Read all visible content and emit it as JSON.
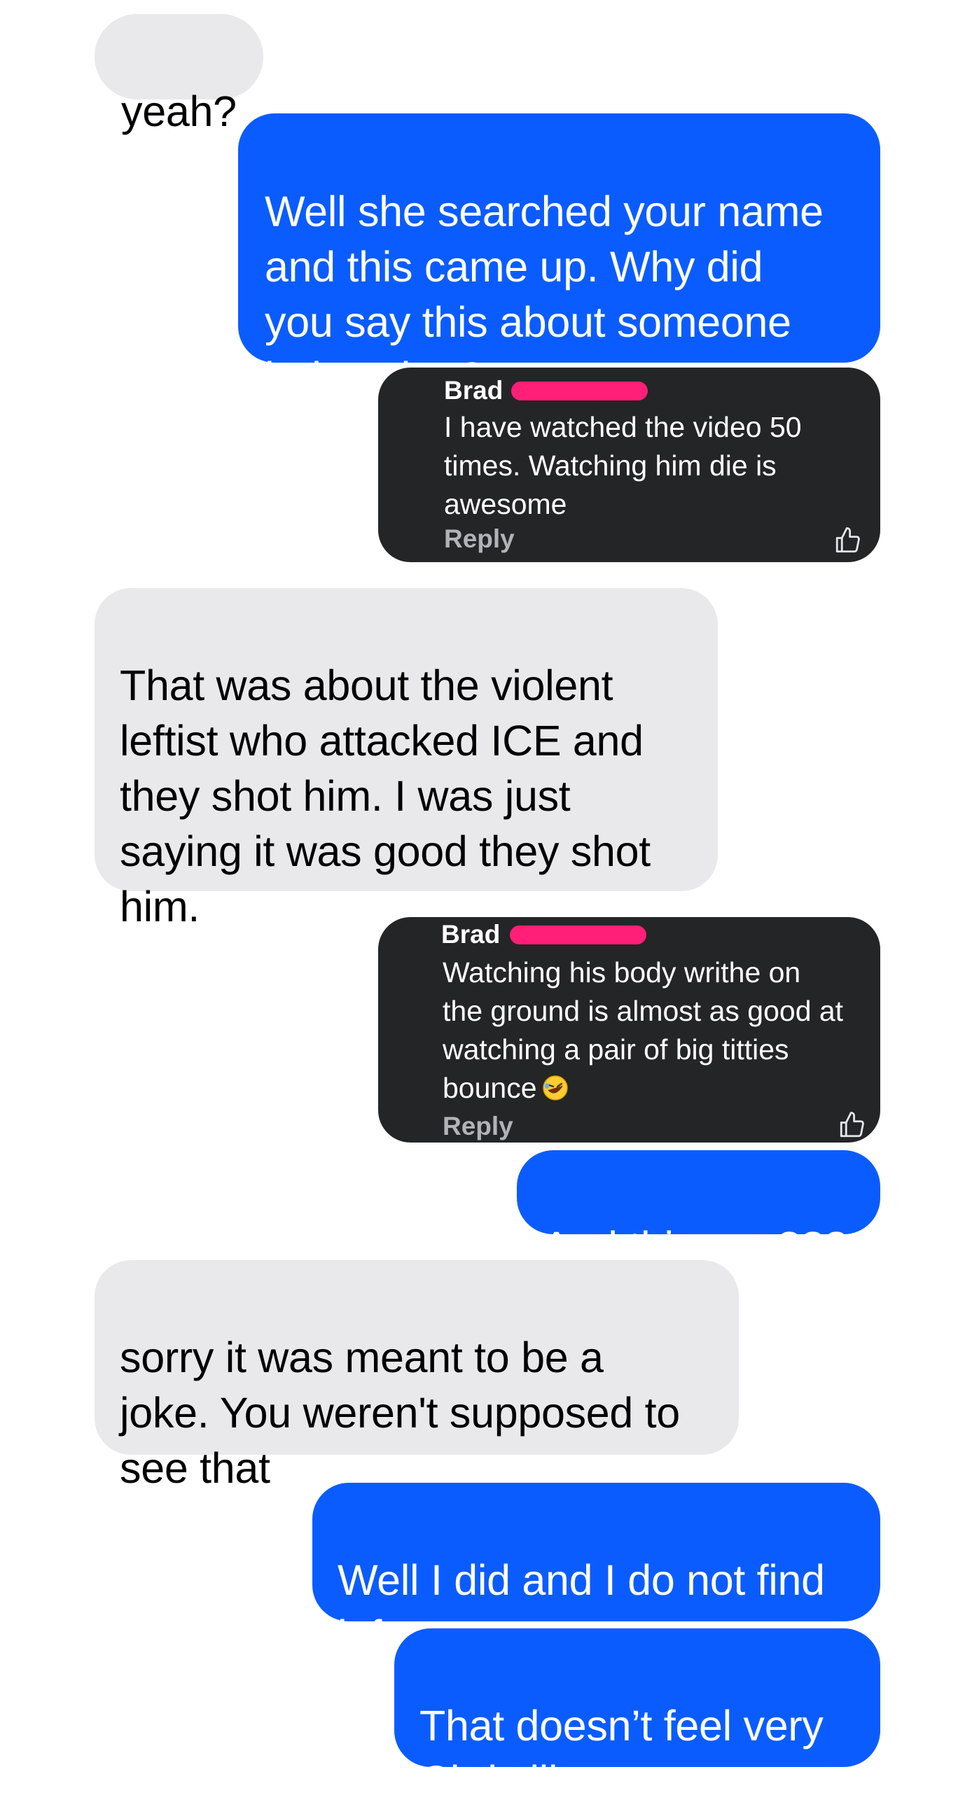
{
  "conversation": {
    "messages": [
      {
        "direction": "incoming",
        "text": "yeah?"
      },
      {
        "direction": "outgoing",
        "text": "Well she searched your name\nand this came up. Why did\nyou say this about someone\nbeing shot?"
      },
      {
        "direction": "outgoing-attachment",
        "comment": {
          "author": "Brad",
          "author_redacted": true,
          "text": "I have watched the video 50\ntimes. Watching him die is\nawesome",
          "reply_label": "Reply"
        }
      },
      {
        "direction": "incoming",
        "text": "That was about the violent\nleftist who attacked ICE and\nthey shot him. I was just\nsaying it was good they shot\nhim."
      },
      {
        "direction": "outgoing-attachment",
        "comment": {
          "author": "Brad",
          "author_redacted": true,
          "text": "Watching his body writhe on\nthe ground is almost as good at\nwatching a pair of big titties\nbounce",
          "emoji": "rolling-on-floor-laughing-emoji",
          "reply_label": "Reply"
        }
      },
      {
        "direction": "outgoing",
        "text": "And this one???"
      },
      {
        "direction": "incoming",
        "text": "sorry it was meant to be a\njoke. You weren't supposed to\nsee that"
      },
      {
        "direction": "outgoing",
        "text": "Well I did and I do not find\nit funny."
      },
      {
        "direction": "outgoing",
        "text": "That doesn’t feel very\nChristlike to me."
      }
    ]
  },
  "colors": {
    "incoming_bubble": "#e9e9eb",
    "outgoing_bubble": "#0b5cff",
    "comment_card": "#242526",
    "redaction": "#ff1f78"
  }
}
